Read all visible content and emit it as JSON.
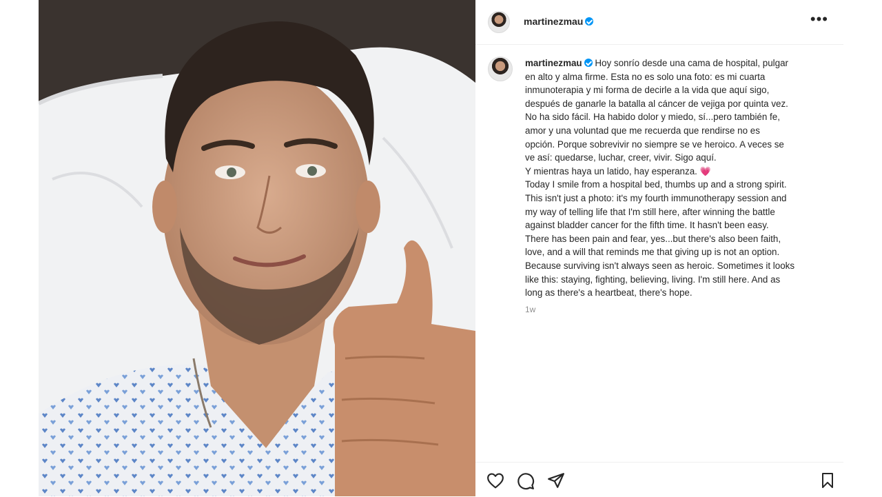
{
  "post": {
    "username": "martinezmau",
    "verified": true,
    "more_label": "•••",
    "caption_lines_es": [
      "Hoy sonrío desde una cama de hospital, pulgar",
      "en alto y alma firme. Esta no es solo una foto: es mi cuarta",
      "inmunoterapia y mi forma de decirle a la vida que aquí sigo,",
      "después de ganarle la batalla al cáncer de vejiga por quinta vez.",
      "No ha sido fácil. Ha habido dolor y miedo, sí...pero también fe,",
      "amor y una voluntad que me recuerda que rendirse no es",
      "opción. Porque sobrevivir no siempre se ve heroico. A veces se",
      "ve así: quedarse, luchar, creer, vivir. Sigo aquí.",
      "Y mientras haya un latido, hay esperanza."
    ],
    "heart_emoji": "💗",
    "caption_lines_en": [
      "Today I smile from a hospital bed, thumbs up and a strong spirit.",
      "This isn't just a photo: it's my fourth immunotherapy session and",
      "my way of telling life that I'm still here, after winning the battle",
      "against bladder cancer for the fifth time. It hasn't been easy.",
      "There has been pain and fear, yes...but there's also been faith,",
      "love, and a will that reminds me that giving up is not an option.",
      "Because surviving isn't always seen as heroic. Sometimes it looks",
      "like this: staying, fighting, believing, living. I'm still here. And as",
      "long as there's a heartbeat, there's hope."
    ],
    "time_ago": "1w"
  },
  "icons": {
    "like": "heart-icon",
    "comment": "comment-icon",
    "share": "share-icon",
    "save": "bookmark-icon",
    "more": "more-options-icon",
    "verified": "verified-badge-icon"
  },
  "colors": {
    "verified": "#0095f6",
    "secondary_text": "#8e8e8e",
    "primary_text": "#262626"
  }
}
